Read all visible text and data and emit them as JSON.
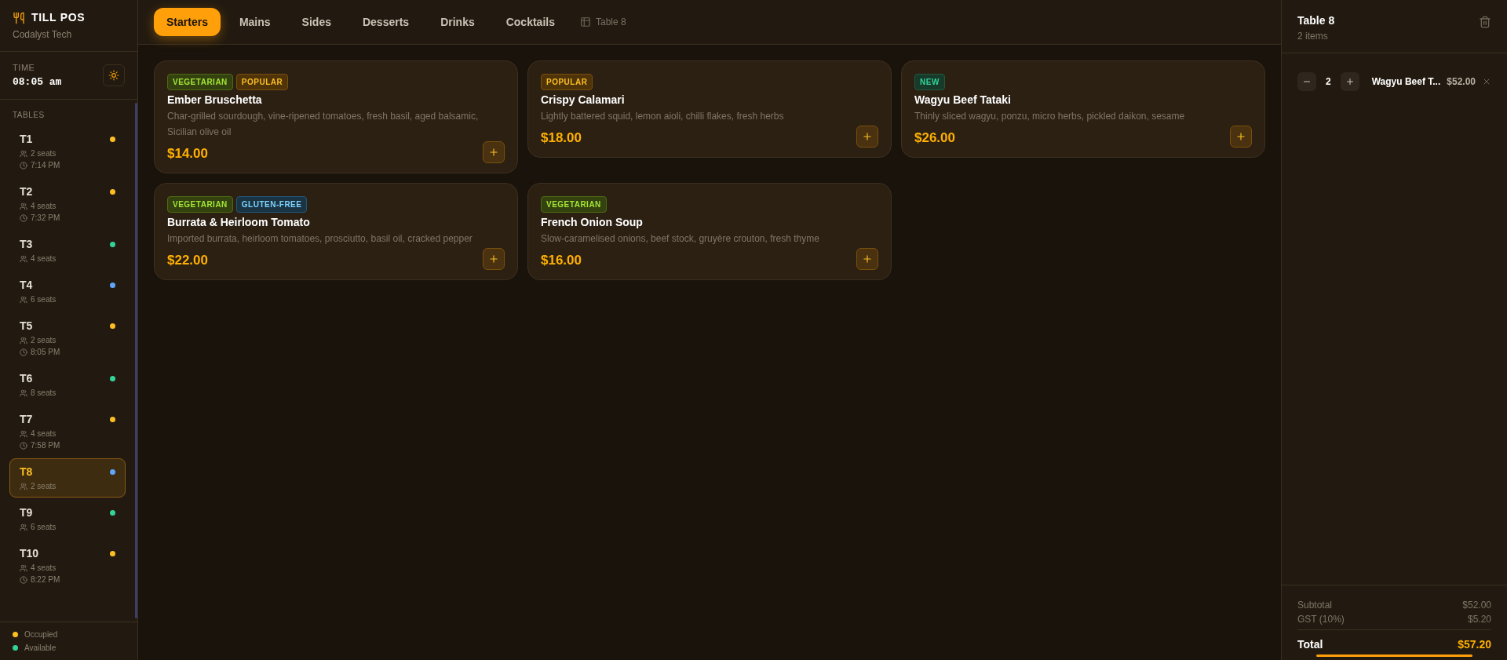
{
  "brand": {
    "name": "TILL POS",
    "subtitle": "Codalyst Tech"
  },
  "time": {
    "label": "TIME",
    "value": "08:05 am"
  },
  "tables_heading": "TABLES",
  "tables": [
    {
      "name": "T1",
      "seats": "2 seats",
      "time": "7:14 PM",
      "color": "#fbbf24",
      "selected": false
    },
    {
      "name": "T2",
      "seats": "4 seats",
      "time": "7:32 PM",
      "color": "#fbbf24",
      "selected": false
    },
    {
      "name": "T3",
      "seats": "4 seats",
      "color": "#34d399",
      "selected": false
    },
    {
      "name": "T4",
      "seats": "6 seats",
      "color": "#60a5fa",
      "selected": false
    },
    {
      "name": "T5",
      "seats": "2 seats",
      "time": "8:05 PM",
      "color": "#fbbf24",
      "selected": false
    },
    {
      "name": "T6",
      "seats": "8 seats",
      "color": "#34d399",
      "selected": false
    },
    {
      "name": "T7",
      "seats": "4 seats",
      "time": "7:58 PM",
      "color": "#fbbf24",
      "selected": false
    },
    {
      "name": "T8",
      "seats": "2 seats",
      "color": "#60a5fa",
      "selected": true
    },
    {
      "name": "T9",
      "seats": "6 seats",
      "color": "#34d399",
      "selected": false
    },
    {
      "name": "T10",
      "seats": "4 seats",
      "time": "8:22 PM",
      "color": "#fbbf24",
      "selected": false
    }
  ],
  "legend": [
    {
      "label": "Occupied",
      "color": "#fbbf24"
    },
    {
      "label": "Available",
      "color": "#34d399"
    }
  ],
  "tabs": [
    {
      "label": "Starters",
      "selected": true
    },
    {
      "label": "Mains",
      "selected": false
    },
    {
      "label": "Sides",
      "selected": false
    },
    {
      "label": "Desserts",
      "selected": false
    },
    {
      "label": "Drinks",
      "selected": false
    },
    {
      "label": "Cocktails",
      "selected": false
    }
  ],
  "current_table": "Table 8",
  "menu_items": [
    {
      "tags": [
        {
          "label": "VEGETARIAN",
          "kind": "vegetarian"
        },
        {
          "label": "POPULAR",
          "kind": "popular"
        }
      ],
      "name": "Ember Bruschetta",
      "description": "Char-grilled sourdough, vine-ripened tomatoes, fresh basil, aged balsamic, Sicilian olive oil",
      "price": "$14.00"
    },
    {
      "tags": [
        {
          "label": "POPULAR",
          "kind": "popular"
        }
      ],
      "name": "Crispy Calamari",
      "description": "Lightly battered squid, lemon aioli, chilli flakes, fresh herbs",
      "price": "$18.00"
    },
    {
      "tags": [
        {
          "label": "NEW",
          "kind": "new"
        }
      ],
      "name": "Wagyu Beef Tataki",
      "description": "Thinly sliced wagyu, ponzu, micro herbs, pickled daikon, sesame",
      "price": "$26.00"
    },
    {
      "tags": [
        {
          "label": "VEGETARIAN",
          "kind": "vegetarian"
        },
        {
          "label": "GLUTEN-FREE",
          "kind": "gluten_free"
        }
      ],
      "name": "Burrata & Heirloom Tomato",
      "description": "Imported burrata, heirloom tomatoes, prosciutto, basil oil, cracked pepper",
      "price": "$22.00"
    },
    {
      "tags": [
        {
          "label": "VEGETARIAN",
          "kind": "vegetarian"
        }
      ],
      "name": "French Onion Soup",
      "description": "Slow-caramelised onions, beef stock, gruyère crouton, fresh thyme",
      "price": "$16.00"
    }
  ],
  "order": {
    "title": "Table 8",
    "count": "2 items",
    "lines": [
      {
        "qty": "2",
        "name": "Wagyu Beef T...",
        "price": "$52.00"
      }
    ],
    "subtotal": {
      "label": "Subtotal",
      "value": "$52.00"
    },
    "tax": {
      "label": "GST (10%)",
      "value": "$5.20"
    },
    "total": {
      "label": "Total",
      "value": "$57.20"
    }
  }
}
